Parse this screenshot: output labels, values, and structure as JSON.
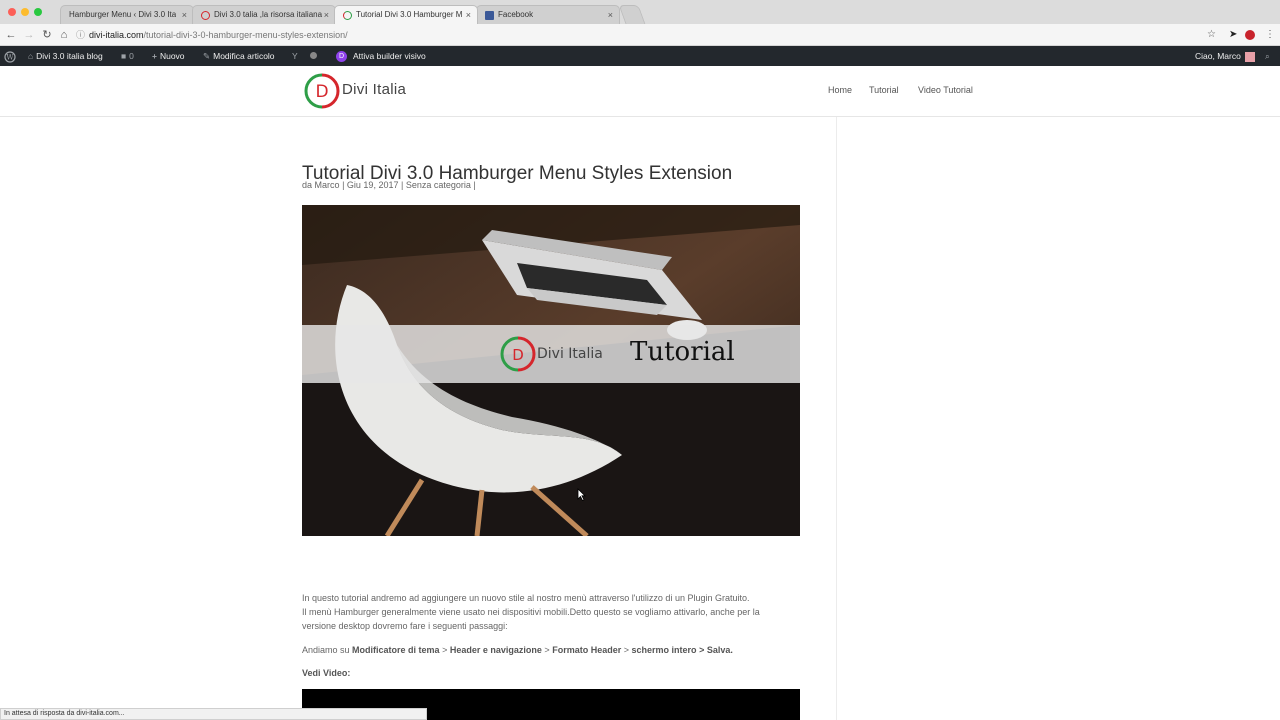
{
  "browser": {
    "tabs": [
      {
        "label": "Hamburger Menu ‹ Divi 3.0 Ita",
        "favicon": "wordpress-icon",
        "active": false
      },
      {
        "label": "Divi 3.0 talia ,la risorsa italiana",
        "favicon": "divi-italia-icon",
        "active": false
      },
      {
        "label": "Tutorial Divi 3.0 Hamburger M",
        "favicon": "divi-italia-icon",
        "active": true
      },
      {
        "label": "Facebook",
        "favicon": "facebook-icon",
        "active": false
      }
    ],
    "tab_close": "×",
    "address": {
      "domain": "divi-italia.com",
      "path": "/tutorial-divi-3-0-hamburger-menu-styles-extension/"
    },
    "status_text": "In attesa di risposta da divi-italia.com..."
  },
  "admin_bar": {
    "site_name": "Divi 3.0 italia blog",
    "comments_count": "0",
    "new_label": "Nuovo",
    "edit_label": "Modifica articolo",
    "builder_label": "Attiva builder visivo",
    "greeting": "Ciao, Marco"
  },
  "header": {
    "logo_text": "Divi Italia",
    "menu": [
      "Home",
      "Tutorial",
      "Video Tutorial"
    ]
  },
  "post": {
    "title": "Tutorial Divi 3.0 Hamburger Menu Styles Extension",
    "meta": {
      "prefix": "da",
      "author": "Marco",
      "sep": "|",
      "date": "Giu 19, 2017",
      "category": "Senza categoria"
    },
    "image": {
      "logo_text": "Divi Italia",
      "banner_text": "Tutorial"
    },
    "paragraph1": "In questo tutorial andremo ad aggiungere un nuovo stile al nostro menù attraverso l'utilizzo di un Plugin Gratuito.",
    "paragraph2": "Il menù Hamburger generalmente viene usato nei dispositivi mobili.Detto questo se  vogliamo attivarlo, anche per la versione desktop dovremo fare i seguenti passaggi:",
    "steps": {
      "prefix": "Andiamo su",
      "s1": "Modificatore di tema",
      "s2": "Header e navigazione",
      "s3": "Formato Header",
      "s4": "schermo intero",
      "s5": "Salva.",
      "arrow": ">"
    },
    "video_label": "Vedi Video:"
  },
  "colors": {
    "admin_bar": "#23282d",
    "divi_purple": "#8f42ec",
    "accent_red": "#d5262c",
    "accent_green": "#2e9e47"
  }
}
